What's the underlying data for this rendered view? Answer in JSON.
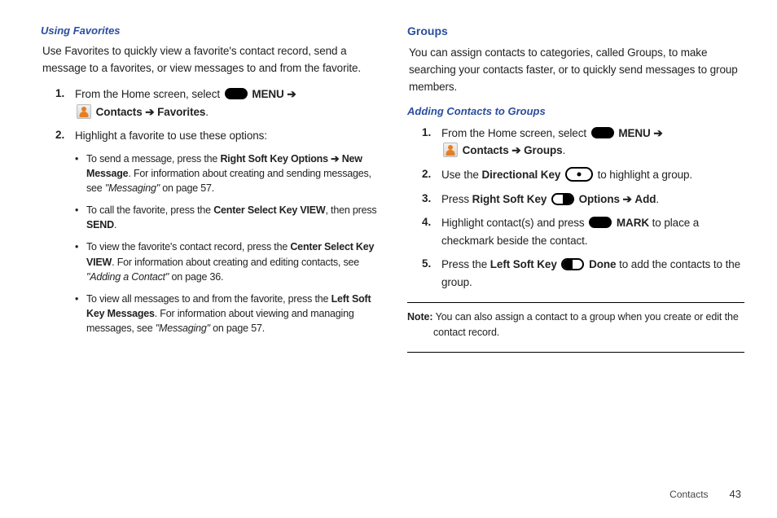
{
  "left": {
    "h_minor": "Using Favorites",
    "intro": "Use Favorites to quickly view a favorite's contact record, send a message to a favorites, or view messages to and from the favorite.",
    "step1_a": "From the Home screen, select ",
    "step1_menu": "MENU",
    "step1_contacts": "Contacts",
    "step1_favorites": "Favorites",
    "step2": "Highlight a favorite to use these options:",
    "b1_a": "To send a message, press the ",
    "b1_b": "Right Soft Key Options",
    "b1_c": "New Message",
    "b1_d": ". For information about creating and sending messages, see ",
    "b1_e": "\"Messaging\"",
    "b1_f": " on page 57.",
    "b2_a": "To call the favorite, press the ",
    "b2_b": "Center Select Key VIEW",
    "b2_c": ", then press ",
    "b2_d": "SEND",
    "b3_a": "To view the favorite's contact record, press the ",
    "b3_b": "Center Select Key VIEW",
    "b3_c": ". For information about creating and editing contacts, see ",
    "b3_d": "\"Adding a Contact\"",
    "b3_e": " on page 36.",
    "b4_a": "To view all messages to and from the favorite, press the ",
    "b4_b": "Left Soft Key Messages",
    "b4_c": ". For information about viewing and managing messages, see ",
    "b4_d": "\"Messaging\"",
    "b4_e": " on page 57."
  },
  "right": {
    "h_major": "Groups",
    "intro": "You can assign contacts to categories, called Groups, to make searching your contacts faster, or to quickly send messages to group members.",
    "h_minor": "Adding Contacts to Groups",
    "s1_a": "From the Home screen, select ",
    "s1_menu": "MENU",
    "s1_contacts": "Contacts",
    "s1_groups": "Groups",
    "s2_a": "Use the ",
    "s2_b": "Directional Key",
    "s2_c": " to highlight a group.",
    "s3_a": "Press ",
    "s3_b": "Right Soft Key",
    "s3_c": "Options",
    "s3_d": "Add",
    "s4_a": "Highlight contact(s) and press ",
    "s4_b": "MARK",
    "s4_c": " to place a checkmark beside the contact.",
    "s5_a": "Press the ",
    "s5_b": "Left Soft Key",
    "s5_c": "Done",
    "s5_d": " to add the contacts to the group.",
    "note_lbl": "Note:",
    "note_a": " You can also assign a contact to a group when you create or edit the ",
    "note_b": "contact record."
  },
  "arrow": "➔",
  "footer": {
    "section": "Contacts",
    "page": "43"
  },
  "nums": {
    "n1": "1.",
    "n2": "2.",
    "n3": "3.",
    "n4": "4.",
    "n5": "5."
  }
}
